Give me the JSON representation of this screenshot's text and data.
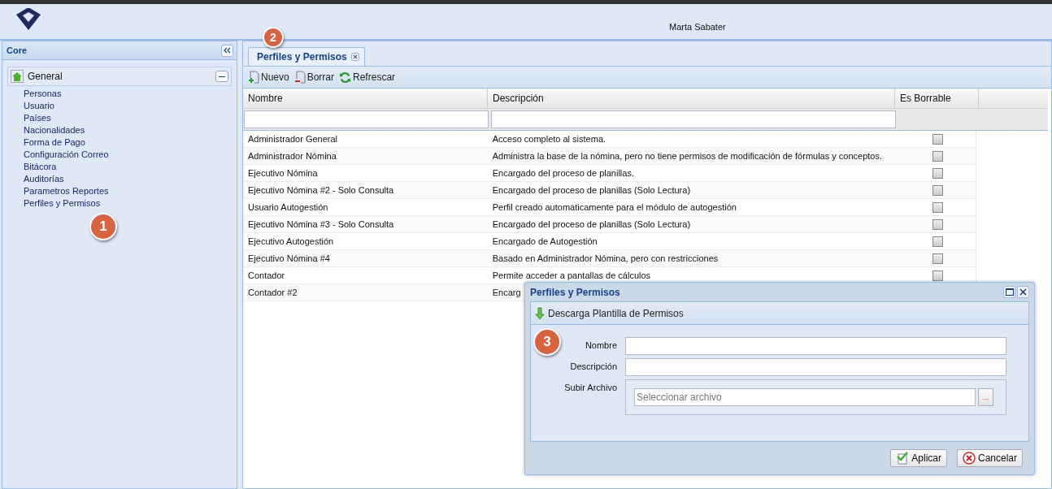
{
  "header": {
    "user_name": "Marta Sabater"
  },
  "sidebar": {
    "title": "Core",
    "group": {
      "label": "General",
      "expanded": true,
      "items": [
        {
          "label": "Personas"
        },
        {
          "label": "Usuario"
        },
        {
          "label": "Países"
        },
        {
          "label": "Nacionalidades"
        },
        {
          "label": "Forma de Pago"
        },
        {
          "label": "Configuración Correo"
        },
        {
          "label": "Bitácora"
        },
        {
          "label": "Auditorías"
        },
        {
          "label": "Parametros Reportes"
        },
        {
          "label": "Perfiles y Permisos"
        }
      ]
    }
  },
  "tabs": [
    {
      "label": "Perfiles y Permisos",
      "selected": true,
      "closable": true
    }
  ],
  "toolbar": [
    {
      "kind": "new",
      "label": "Nuevo"
    },
    {
      "kind": "delete",
      "label": "Borrar"
    },
    {
      "kind": "refresh",
      "label": "Refrescar"
    }
  ],
  "table": {
    "columns": [
      "Nombre",
      "Descripción",
      "Es Borrable"
    ],
    "rows": [
      {
        "nombre": "Administrador General",
        "descripcion": "Acceso completo al sistema.",
        "borrable": false
      },
      {
        "nombre": "Administrador Nómina",
        "descripcion": "Administra la base de la nómina, pero no tiene permisos de modificación de fórmulas y conceptos.",
        "borrable": false
      },
      {
        "nombre": "Ejecutivo Nómina",
        "descripcion": "Encargado del proceso de planillas.",
        "borrable": false
      },
      {
        "nombre": "Ejecutivo Nómina #2 - Solo Consulta",
        "descripcion": "Encargado del proceso de planillas (Solo Lectura)",
        "borrable": false
      },
      {
        "nombre": "Usuario Autogestión",
        "descripcion": "Perfil creado automaticamente para el módulo de autogestión",
        "borrable": false
      },
      {
        "nombre": "Ejecutivo Nómina #3 - Solo Consulta",
        "descripcion": "Encargado del proceso de planillas (Solo Lectura)",
        "borrable": false
      },
      {
        "nombre": "Ejecutivo Autogestión",
        "descripcion": "Encargado de Autogestión",
        "borrable": false
      },
      {
        "nombre": "Ejecutivo Nómina #4",
        "descripcion": "Basado en Administrador Nómina, pero con restricciones",
        "borrable": false
      },
      {
        "nombre": "Contador",
        "descripcion": "Permite acceder a pantallas de cálculos",
        "borrable": false
      },
      {
        "nombre": "Contador #2",
        "descripcion": "Encarg"
      }
    ]
  },
  "dialog": {
    "title": "Perfiles y Permisos",
    "toolbar_button": "Descarga Plantilla de Permisos",
    "fields": [
      {
        "kind": "text",
        "label": "Nombre"
      },
      {
        "kind": "text",
        "label": "Descripción"
      },
      {
        "kind": "file",
        "label": "Subir Archivo",
        "placeholder": "Seleccionar archivo",
        "button": "..."
      }
    ],
    "buttons": [
      {
        "kind": "apply",
        "label": "Aplicar"
      },
      {
        "kind": "cancel",
        "label": "Cancelar"
      }
    ]
  },
  "callouts": [
    "1",
    "2",
    "3"
  ]
}
